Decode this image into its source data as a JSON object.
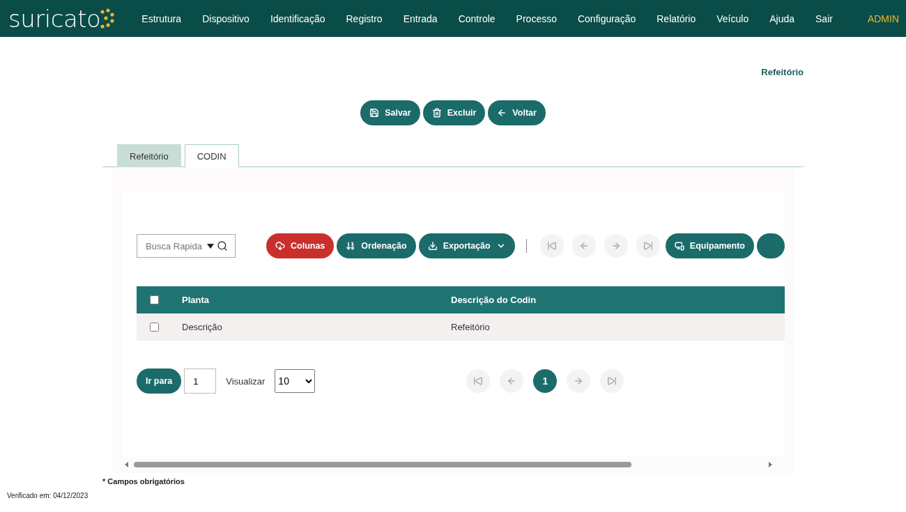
{
  "brand": "suricato",
  "nav": [
    "Estrutura",
    "Dispositivo",
    "Identificação",
    "Registro",
    "Entrada",
    "Controle",
    "Processo",
    "Configuração",
    "Relatório",
    "Veículo",
    "Ajuda",
    "Sair"
  ],
  "user": "ADMIN",
  "page_title": "Refeitório",
  "actions": [
    {
      "label": "Salvar"
    },
    {
      "label": "Excluir"
    },
    {
      "label": "Voltar"
    }
  ],
  "tabs": [
    {
      "label": "Refeitório",
      "selected": false
    },
    {
      "label": "CODIN",
      "selected": true
    }
  ],
  "search": {
    "placeholder": "Busca Rapida"
  },
  "toolbar": [
    {
      "kind": "button",
      "label": "Colunas",
      "color": "#c9302c",
      "dropdown": false
    },
    {
      "kind": "button",
      "label": "Ordenação",
      "color": "#1b6b6b",
      "dropdown": false
    },
    {
      "kind": "button",
      "label": "Exportação",
      "color": "#1b6b6b",
      "dropdown": true
    },
    {
      "kind": "separator"
    },
    {
      "kind": "nav",
      "disabled": true
    },
    {
      "kind": "nav",
      "disabled": true
    },
    {
      "kind": "nav",
      "disabled": true
    },
    {
      "kind": "nav",
      "disabled": true
    },
    {
      "kind": "button",
      "label": "Equipamento",
      "color": "#1b6b6b",
      "dropdown": false
    },
    {
      "kind": "stub",
      "color": "#1b6b6b"
    }
  ],
  "table": {
    "header_checked": false,
    "columns": [
      "Planta",
      "Descrição do Codin"
    ],
    "rows": [
      {
        "checked": false,
        "cells": [
          "Descrição",
          "Refeitório"
        ]
      }
    ]
  },
  "footer": {
    "goto_label": "Ir para",
    "goto_value": "1",
    "view_label": "Visualizar",
    "page_size": "10",
    "pager": [
      {
        "kind": "first",
        "disabled": true
      },
      {
        "kind": "prev",
        "disabled": true
      },
      {
        "kind": "page",
        "label": "1",
        "selected": true
      },
      {
        "kind": "next",
        "disabled": true
      },
      {
        "kind": "last",
        "disabled": true
      }
    ]
  },
  "required_note": "* Campos obrigatórios",
  "verified": "Verificado em: 04/12/2023"
}
